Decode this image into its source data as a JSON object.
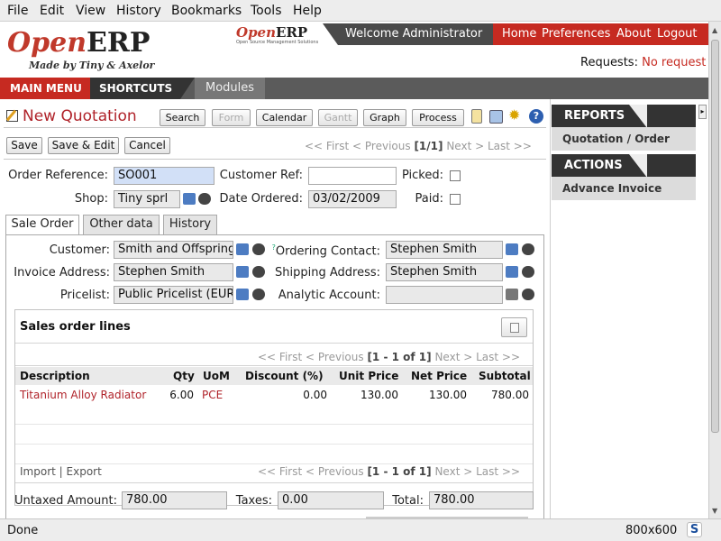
{
  "menubar": {
    "items": [
      "File",
      "Edit",
      "View",
      "History",
      "Bookmarks",
      "Tools",
      "Help"
    ]
  },
  "header": {
    "logo_open": "Open",
    "logo_erp": "ERP",
    "logo_tagline": "Made by Tiny & Axelor",
    "small_logo_open": "Open",
    "small_logo_erp": "ERP",
    "small_logo_tagline": "Open Source Management Solutions",
    "welcome": "Welcome Administrator",
    "links": [
      "Home",
      "Preferences",
      "About",
      "Logout"
    ],
    "requests_label": "Requests:",
    "requests_value": "No request"
  },
  "mainnav": {
    "main_menu": "MAIN MENU",
    "shortcuts": "SHORTCUTS",
    "modules": "Modules"
  },
  "title": {
    "text": "New Quotation",
    "view_buttons": [
      "Search",
      "Form",
      "Calendar",
      "Gantt",
      "Graph",
      "Process"
    ]
  },
  "actions": {
    "save": "Save",
    "save_edit": "Save & Edit",
    "cancel": "Cancel",
    "pager": {
      "first": "<< First",
      "previous": "< Previous",
      "count": "[1/1]",
      "next": "Next >",
      "last": "Last >>"
    }
  },
  "form": {
    "order_ref_label": "Order Reference:",
    "order_ref_value": "SO001",
    "customer_ref_label": "Customer Ref:",
    "customer_ref_value": "",
    "picked_label": "Picked:",
    "shop_label": "Shop:",
    "shop_value": "Tiny sprl",
    "date_ordered_label": "Date Ordered:",
    "date_ordered_value": "03/02/2009",
    "paid_label": "Paid:"
  },
  "tabs": [
    "Sale Order",
    "Other data",
    "History"
  ],
  "sale_order": {
    "customer_label": "Customer:",
    "customer_value": "Smith and Offspring",
    "ordering_contact_label": "Ordering Contact:",
    "ordering_contact_help": "?",
    "ordering_contact_value": "Stephen Smith",
    "invoice_address_label": "Invoice Address:",
    "invoice_address_value": "Stephen Smith",
    "shipping_address_label": "Shipping Address:",
    "shipping_address_value": "Stephen Smith",
    "pricelist_label": "Pricelist:",
    "pricelist_value": "Public Pricelist (EUR)",
    "analytic_account_label": "Analytic Account:",
    "analytic_account_value": ""
  },
  "lines": {
    "title": "Sales order lines",
    "pager": {
      "first": "<< First",
      "previous": "< Previous",
      "count": "[1 - 1 of 1]",
      "next": "Next >",
      "last": "Last >>"
    },
    "columns": [
      "Description",
      "Qty",
      "UoM",
      "Discount (%)",
      "Unit Price",
      "Net Price",
      "Subtotal"
    ],
    "rows": [
      {
        "description": "Titanium Alloy Radiator",
        "qty": "6.00",
        "uom": "PCE",
        "discount": "0.00",
        "unit_price": "130.00",
        "net_price": "130.00",
        "subtotal": "780.00"
      }
    ],
    "import": "Import",
    "separator": "|",
    "export": "Export"
  },
  "totals": {
    "untaxed_label": "Untaxed Amount:",
    "untaxed_value": "780.00",
    "taxes_label": "Taxes:",
    "taxes_value": "0.00",
    "total_label": "Total:",
    "total_value": "780.00"
  },
  "sidebar": {
    "reports_title": "REPORTS",
    "reports_items": [
      "Quotation / Order"
    ],
    "actions_title": "ACTIONS",
    "actions_items": [
      "Advance Invoice"
    ]
  },
  "status": {
    "text": "Done",
    "resolution": "800x600"
  },
  "colors": {
    "accent_red": "#c62a21",
    "dark": "#333333",
    "link_red": "#b0232a"
  },
  "icons": [
    "open-folder-icon",
    "magnifier-icon",
    "attachment-icon",
    "print-icon",
    "bug-icon",
    "help-icon",
    "list-toggle-icon",
    "s-plugin-icon"
  ]
}
